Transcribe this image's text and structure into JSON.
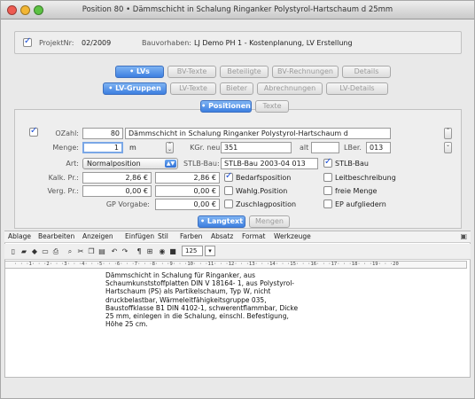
{
  "window": {
    "title": "Position 80 • Dämmschicht in Schalung Ringanker Polystyrol-Hartschaum d 25mm"
  },
  "project": {
    "nr_label": "ProjektNr:",
    "nr_value": "02/2009",
    "bauvorhaben_label": "Bauvorhaben:",
    "bauvorhaben_value": "LJ Demo PH 1 - Kostenplanung, LV Erstellung"
  },
  "tabs_row1": [
    "• LVs",
    "BV-Texte",
    "Beteiligte",
    "BV-Rechnungen",
    "Details"
  ],
  "tabs_row2": [
    "• LV-Gruppen",
    "LV-Texte",
    "Bieter",
    "Abrechnungen",
    "LV-Details"
  ],
  "tabs_row3": [
    "• Positionen",
    "Texte"
  ],
  "position": {
    "ozahl_label": "OZahl:",
    "ozahl_value": "80",
    "ozahl_text": "Dämmschicht in Schalung Ringanker Polystyrol-Hartschaum d",
    "menge_label": "Menge:",
    "menge_value": "1",
    "unit": "m",
    "kgr_label": "KGr. neu:",
    "kgr_value": "351",
    "alt_label": "alt",
    "lber_label": "LBer.",
    "lber_value": "013",
    "art_label": "Art:",
    "art_value": "Normalposition",
    "stlb_label": "STLB-Bau:",
    "stlb_value": "STLB-Bau  2003-04 013",
    "stlb_check_label": "STLB-Bau",
    "kalk_label": "Kalk. Pr.:",
    "kalk_value1": "2,86 €",
    "kalk_value2": "2,86 €",
    "verg_label": "Verg. Pr.:",
    "verg_value1": "0,00 €",
    "verg_value2": "0,00 €",
    "gp_label": "GP Vorgabe:",
    "gp_value": "0,00 €",
    "check_bedarf": "Bedarfsposition",
    "check_wahl": "Wahlg.Position",
    "check_zuschlag": "Zuschlagposition",
    "check_leit": "Leitbeschreibung",
    "check_freie": "freie Menge",
    "check_ep": "EP aufgliedern"
  },
  "tabs_row4": [
    "• Langtext",
    "Mengen"
  ],
  "menubar": [
    "Ablage",
    "Bearbeiten",
    "Anzeigen",
    "Einfügen",
    "Stil",
    "Farben",
    "Absatz",
    "Format",
    "Werkzeuge"
  ],
  "toolbar": {
    "zoom": "125"
  },
  "ruler": "· · ·1· · ·2· · ·3· · ·4· · ·5· · ·6· · ·7· · ·8· · ·9· · ·10· · ·11· · ·12· · ·13· · ·14· · ·15· · ·16· · ·17· · ·18· · ·19· · ·20",
  "langtext": [
    "Dämmschicht in Schalung für Ringanker, aus",
    "Schaumkunststoffplatten DIN V  18164- 1, aus Polystyrol-",
    "Hartschaum (PS) als Partikelschaum, Typ W, nicht",
    "druckbelastbar, Wärmeleitfähigkeitsgruppe 035,",
    "Baustoffklasse B1 DIN  4102-1, schwerentflammbar, Dicke",
    "25 mm, einlegen in die Schalung, einschl. Befestigung,",
    "Höhe 25 cm."
  ]
}
